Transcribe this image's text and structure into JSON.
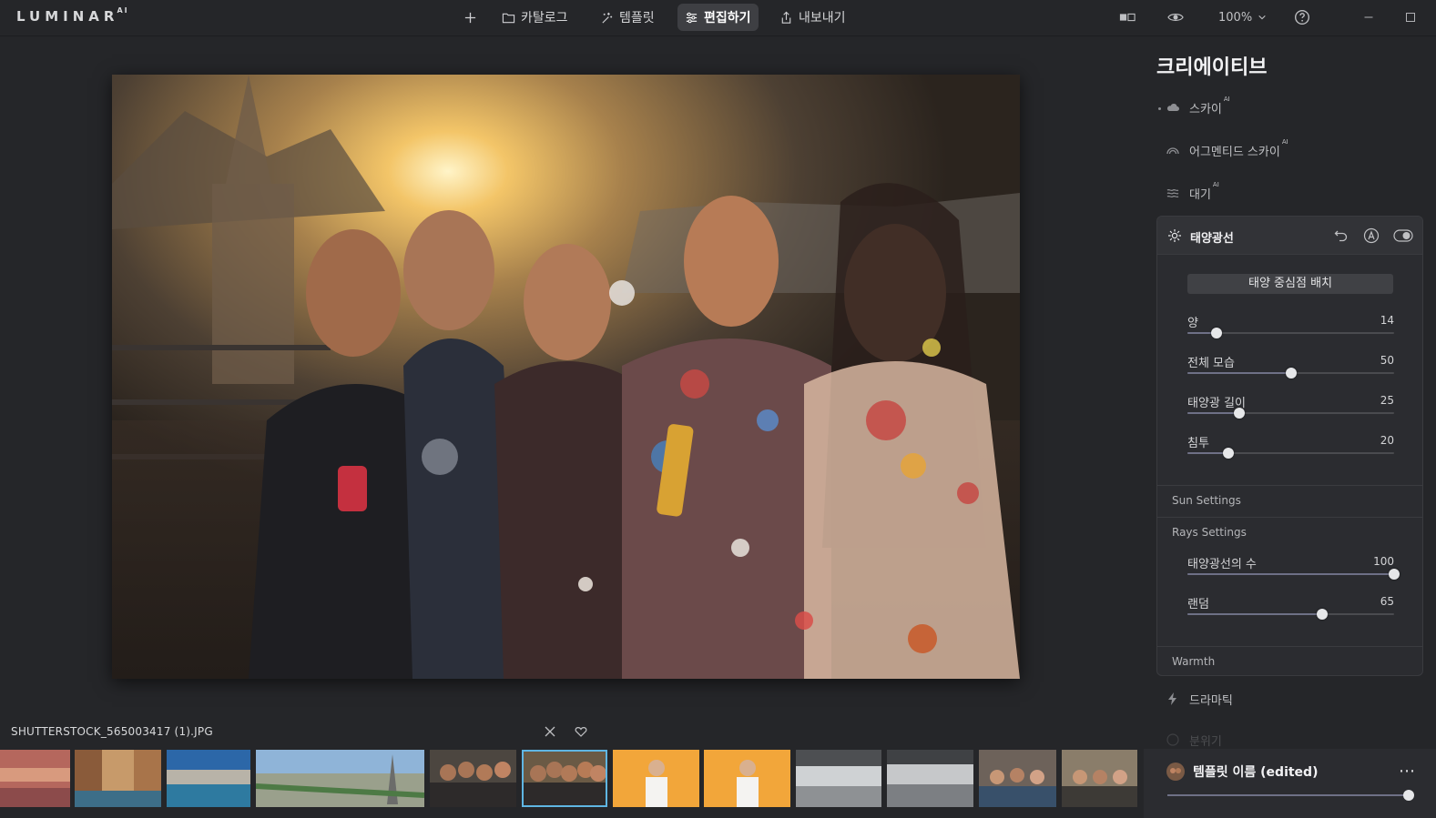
{
  "app": {
    "logo": "LUMINAR",
    "logo_suffix": "AI"
  },
  "nav": {
    "add_label": "+",
    "catalog_label": "카탈로그",
    "templates_label": "템플릿",
    "edit_label": "편집하기",
    "export_label": "내보내기"
  },
  "toolbar": {
    "zoom_value": "100%"
  },
  "file": {
    "name": "SHUTTERSTOCK_565003417 (1).JPG"
  },
  "panel": {
    "title": "크리에이티브",
    "tools": [
      {
        "label": "스카이",
        "ai": "AI",
        "icon": "cloud-icon"
      },
      {
        "label": "어그멘티드 스카이",
        "ai": "AI",
        "icon": "rainbow-icon"
      },
      {
        "label": "대기",
        "ai": "AI",
        "icon": "haze-icon"
      },
      {
        "label": "드라마틱",
        "icon": "lightning-icon"
      },
      {
        "label": "분위기",
        "icon": "mood-icon"
      }
    ],
    "sunrays": {
      "title": "태양광선",
      "place_sun_label": "태양 중심점 배치",
      "sliders": [
        {
          "label": "양",
          "value": 14,
          "fraction": 0.14
        },
        {
          "label": "전체 모습",
          "value": 50,
          "fraction": 0.5
        },
        {
          "label": "태양광 길이",
          "value": 25,
          "fraction": 0.25
        },
        {
          "label": "침투",
          "value": 20,
          "fraction": 0.2
        }
      ],
      "sun_settings_label": "Sun Settings",
      "rays_settings_label": "Rays Settings",
      "rays_sliders": [
        {
          "label": "태양광선의 수",
          "value": 100,
          "fraction": 1.0
        },
        {
          "label": "랜덤",
          "value": 65,
          "fraction": 0.65
        }
      ],
      "warmth_label": "Warmth"
    }
  },
  "template": {
    "name": "템플릿 이름 (edited)",
    "more_label": "⋯",
    "amount_fraction": 1.0
  },
  "colors": {
    "accent": "#5fb6e3",
    "background": "#252629",
    "panel": "#2b2c30"
  }
}
